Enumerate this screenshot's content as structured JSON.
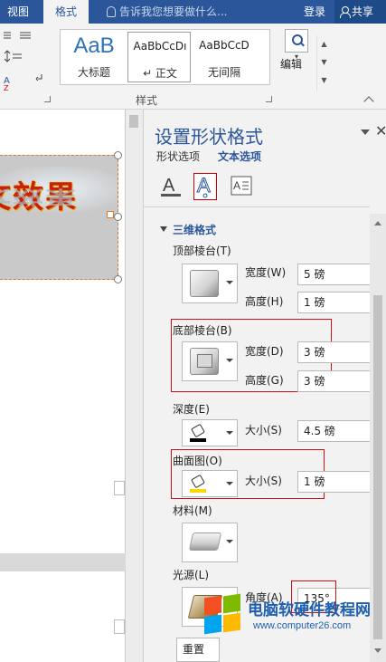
{
  "titlebar": {
    "tab_view": "视图",
    "tab_format": "格式",
    "tell_me_placeholder": "告诉我您想要做什么...",
    "login": "登录",
    "share": "共享"
  },
  "ribbon": {
    "styles": [
      {
        "sample": "AaB",
        "label": "大标题"
      },
      {
        "sample": "AaBbCcDı",
        "label": "↵ 正文"
      },
      {
        "sample": "AaBbCcD",
        "label": "无间隔"
      }
    ],
    "styles_group_label": "样式",
    "edit_label": "编辑"
  },
  "document": {
    "wordart_text": "文效果"
  },
  "pane": {
    "title": "设置形状格式",
    "tab_shape_options": "形状选项",
    "tab_text_options": "文本选项",
    "section_3d": "三维格式",
    "top_bevel": "顶部棱台(T)",
    "top_width_label": "宽度(W)",
    "top_width_value": "5 磅",
    "top_height_label": "高度(H)",
    "top_height_value": "1 磅",
    "bottom_bevel": "底部棱台(B)",
    "bottom_width_label": "宽度(D)",
    "bottom_width_value": "3 磅",
    "bottom_height_label": "高度(G)",
    "bottom_height_value": "3 磅",
    "depth": "深度(E)",
    "depth_size_label": "大小(S)",
    "depth_size_value": "4.5 磅",
    "contour": "曲面图(O)",
    "contour_size_label": "大小(S)",
    "contour_size_value": "1 磅",
    "material": "材料(M)",
    "lighting": "光源(L)",
    "angle_label": "角度(A)",
    "angle_value": "135°",
    "reset": "重置"
  },
  "watermark": {
    "title": "电脑软硬件教程网",
    "url": "www.computer26.com"
  },
  "colors": {
    "accent": "#2b579a",
    "highlight_red": "#d01010",
    "depth_color": "#000000",
    "contour_color": "#ffd700"
  }
}
